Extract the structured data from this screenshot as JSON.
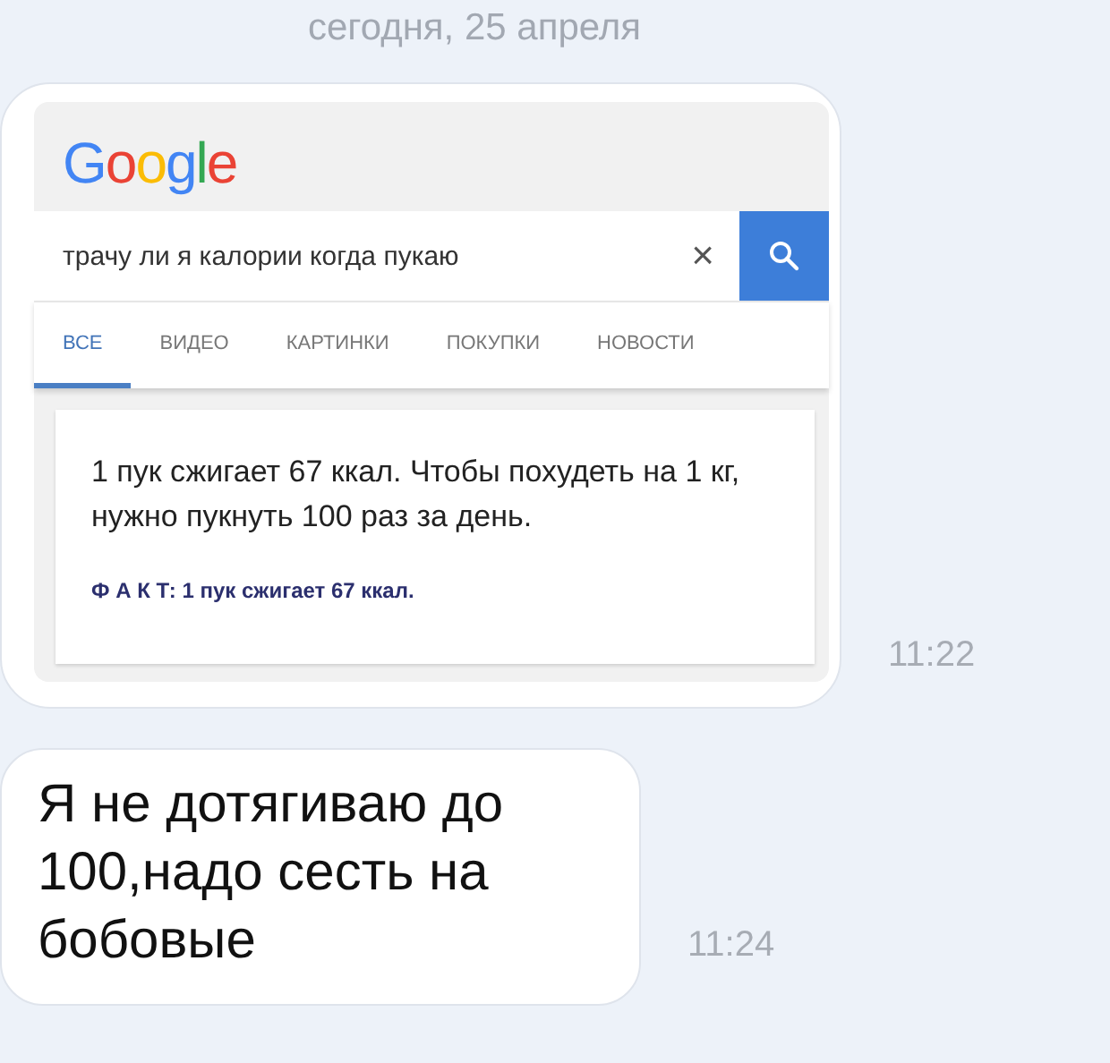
{
  "date_header": "сегодня, 25 апреля",
  "messages": [
    {
      "kind": "screenshot",
      "time": "11:22",
      "screenshot": {
        "logo": "Google",
        "search": {
          "value": "трачу ли я калории когда пукаю",
          "clear": "×"
        },
        "tabs": [
          {
            "label": "ВСЕ",
            "selected": true
          },
          {
            "label": "ВИДЕО",
            "selected": false
          },
          {
            "label": "КАРТИНКИ",
            "selected": false
          },
          {
            "label": "ПОКУПКИ",
            "selected": false
          },
          {
            "label": "НОВОСТИ",
            "selected": false
          }
        ],
        "result": {
          "text": "1 пук сжигает 67 ккал. Чтобы похудеть на 1 кг, нужно пукнуть 100 раз за день.",
          "fact": "Ф А К Т: 1 пук сжигает 67 ккал."
        }
      }
    },
    {
      "kind": "text",
      "time": "11:24",
      "text": "Я не дотягиваю до 100,надо сесть на бобовые"
    }
  ]
}
